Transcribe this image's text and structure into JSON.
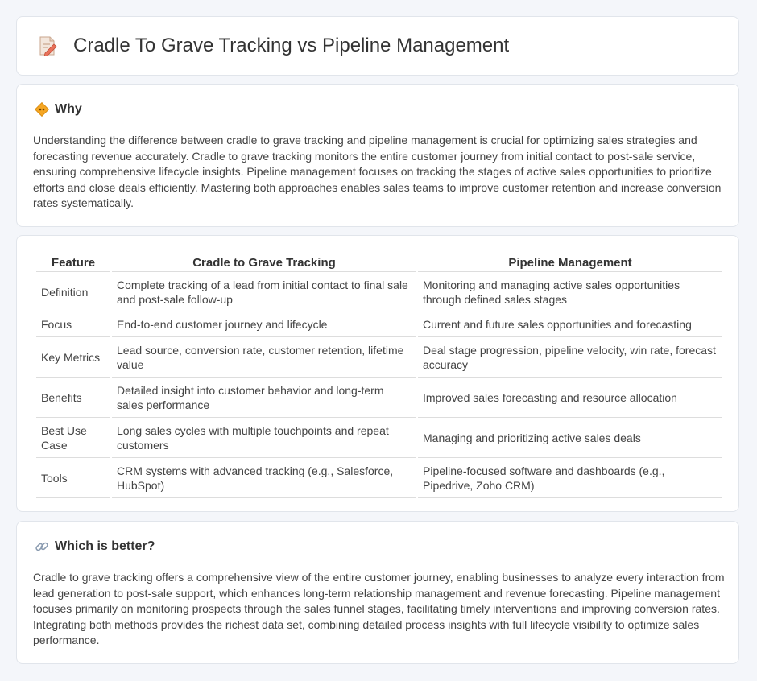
{
  "header": {
    "title": "Cradle To Grave Tracking vs Pipeline Management",
    "icon": "document-pencil-icon"
  },
  "why": {
    "heading": "Why",
    "icon": "diamond-sign-icon",
    "text": "Understanding the difference between cradle to grave tracking and pipeline management is crucial for optimizing sales strategies and forecasting revenue accurately. Cradle to grave tracking monitors the entire customer journey from initial contact to post-sale service, ensuring comprehensive lifecycle insights. Pipeline management focuses on tracking the stages of active sales opportunities to prioritize efforts and close deals efficiently. Mastering both approaches enables sales teams to improve customer retention and increase conversion rates systematically."
  },
  "table": {
    "headers": [
      "Feature",
      "Cradle to Grave Tracking",
      "Pipeline Management"
    ],
    "rows": [
      [
        "Definition",
        "Complete tracking of a lead from initial contact to final sale and post-sale follow-up",
        "Monitoring and managing active sales opportunities through defined sales stages"
      ],
      [
        "Focus",
        "End-to-end customer journey and lifecycle",
        "Current and future sales opportunities and forecasting"
      ],
      [
        "Key Metrics",
        "Lead source, conversion rate, customer retention, lifetime value",
        "Deal stage progression, pipeline velocity, win rate, forecast accuracy"
      ],
      [
        "Benefits",
        "Detailed insight into customer behavior and long-term sales performance",
        "Improved sales forecasting and resource allocation"
      ],
      [
        "Best Use Case",
        "Long sales cycles with multiple touchpoints and repeat customers",
        "Managing and prioritizing active sales deals"
      ],
      [
        "Tools",
        "CRM systems with advanced tracking (e.g., Salesforce, HubSpot)",
        "Pipeline-focused software and dashboards (e.g., Pipedrive, Zoho CRM)"
      ]
    ]
  },
  "better": {
    "heading": "Which is better?",
    "icon": "link-icon",
    "text": "Cradle to grave tracking offers a comprehensive view of the entire customer journey, enabling businesses to analyze every interaction from lead generation to post-sale support, which enhances long-term relationship management and revenue forecasting. Pipeline management focuses primarily on monitoring prospects through the sales funnel stages, facilitating timely interventions and improving conversion rates. Integrating both methods provides the richest data set, combining detailed process insights with full lifecycle visibility to optimize sales performance."
  }
}
